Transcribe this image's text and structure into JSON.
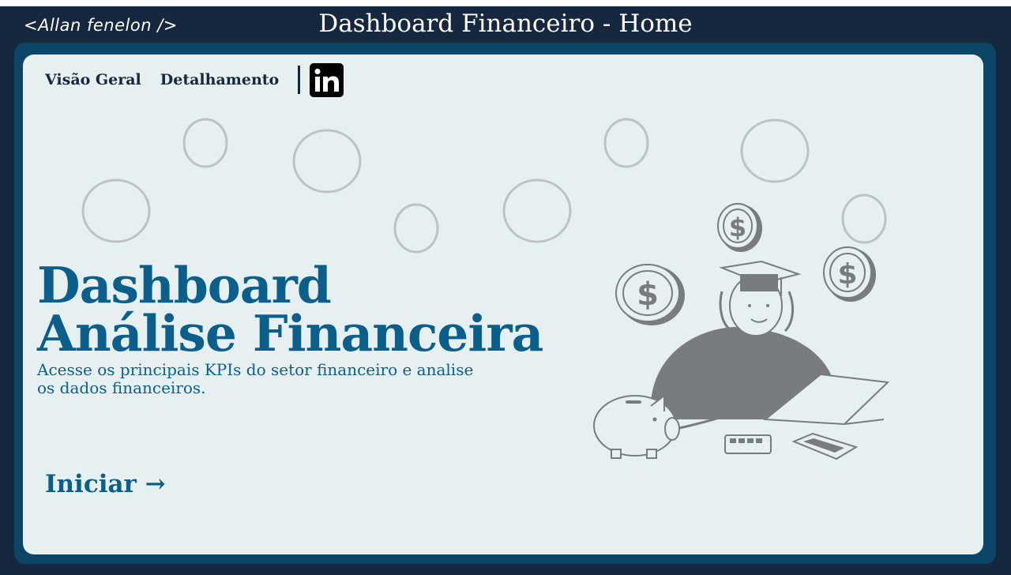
{
  "header": {
    "brand": "<Allan fenelon />",
    "title": "Dashboard Financeiro - Home"
  },
  "nav": {
    "items": [
      {
        "label": "Visão Geral"
      },
      {
        "label": "Detalhamento"
      }
    ],
    "social_icon": "linkedin-icon"
  },
  "hero": {
    "headline_line1": "Dashboard",
    "headline_line2": "Análise Financeira",
    "description": "Acesse os principais KPIs do setor financeiro e analise os dados financeiros.",
    "cta_label": "Iniciar →"
  },
  "colors": {
    "background_dark": "#16283f",
    "frame": "#0c4566",
    "panel": "#e6f0f1",
    "accent": "#0b5f8d",
    "illustration": "#787c7e"
  }
}
